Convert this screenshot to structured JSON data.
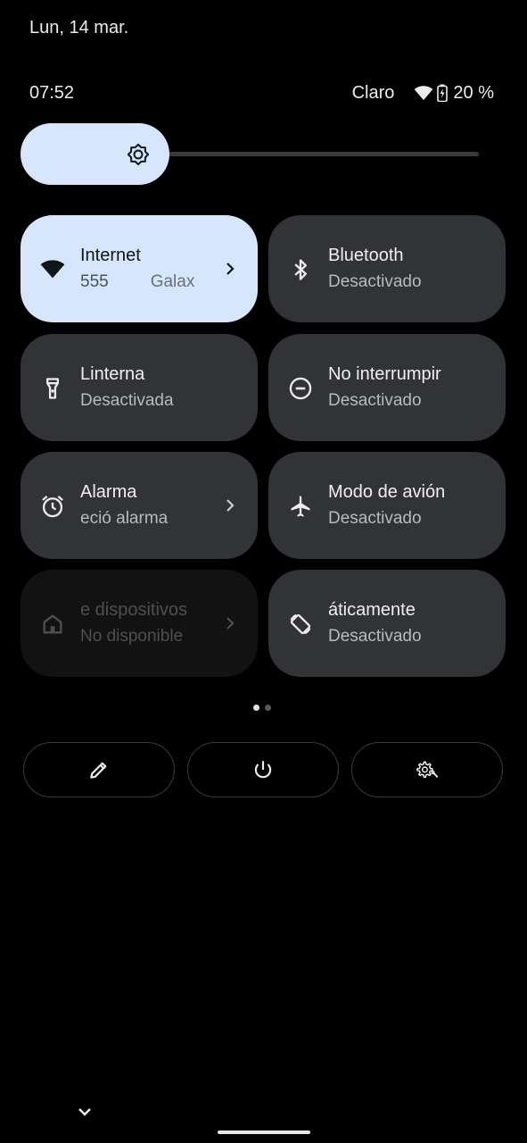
{
  "header": {
    "date": "Lun, 14 mar."
  },
  "status_bar": {
    "time": "07:52",
    "carrier": "Claro",
    "battery": "20 %",
    "icons": [
      "wifi-icon",
      "battery-charging-icon"
    ]
  },
  "brightness": {
    "level": 0.32,
    "icon": "brightness-icon"
  },
  "tiles": [
    {
      "label": "Internet",
      "sub": "555",
      "sub2": "Galax",
      "icon": "wifi-icon",
      "state": "active",
      "chevron": true
    },
    {
      "label": "Bluetooth",
      "sub": "Desactivado",
      "icon": "bluetooth-icon",
      "state": "off",
      "chevron": false
    },
    {
      "label": "Linterna",
      "sub": "Desactivada",
      "icon": "flashlight-icon",
      "state": "off",
      "chevron": false
    },
    {
      "label": "No interrumpir",
      "sub": "Desactivado",
      "icon": "do-not-disturb-icon",
      "state": "off",
      "chevron": false
    },
    {
      "label": "Alarma",
      "sub": "eció alarma",
      "icon": "alarm-icon",
      "state": "off",
      "chevron": true
    },
    {
      "label": "Modo de avión",
      "sub": "Desactivado",
      "icon": "airplane-icon",
      "state": "off",
      "chevron": false
    },
    {
      "label": "e dispositivos",
      "sub": "No disponible",
      "icon": "home-icon",
      "state": "unavailable",
      "chevron": true
    },
    {
      "label": "áticamente",
      "sub": "Desactivado",
      "icon": "auto-rotate-icon",
      "state": "off",
      "chevron": false
    }
  ],
  "pager": {
    "pages": 2,
    "current": 1
  },
  "actions": [
    {
      "icon": "edit-icon"
    },
    {
      "icon": "power-icon"
    },
    {
      "icon": "settings-icon"
    }
  ],
  "colors": {
    "active_tile": "#d6e7fd",
    "tile": "#323336",
    "background": "#000000"
  }
}
